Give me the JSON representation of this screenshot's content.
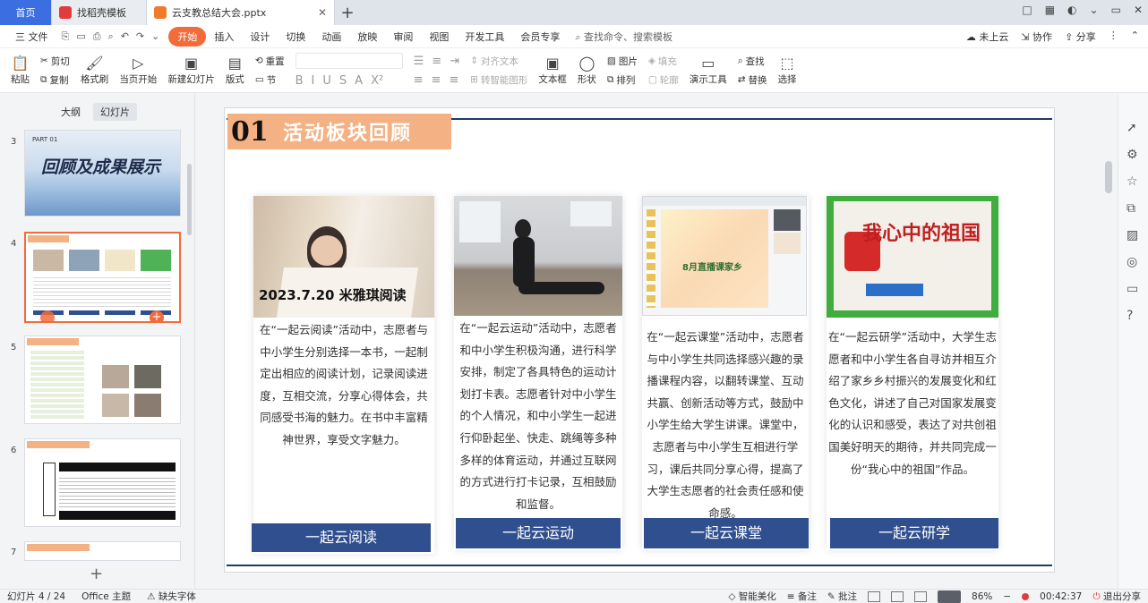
{
  "tabs": {
    "home": "首页",
    "t1": "找稻壳模板",
    "t2": "云支教总结大会.pptx",
    "add": "+"
  },
  "window_controls": [
    "□",
    "▦",
    "◐",
    "⌄",
    "▭",
    "✕"
  ],
  "menu": {
    "file": "三 文件",
    "quick_icons": [
      "⎘",
      "▭",
      "⎙",
      "⌕",
      "↶",
      "↷",
      "⌄"
    ],
    "items": [
      "开始",
      "插入",
      "设计",
      "切换",
      "动画",
      "放映",
      "审阅",
      "视图",
      "开发工具",
      "会员专享"
    ],
    "search": "⌕ 查找命令、搜索模板",
    "right": [
      "☁ 未上云",
      "⇲ 协作",
      "⇪ 分享",
      "⋮",
      "⌃"
    ]
  },
  "ribbon": {
    "paste": "粘贴",
    "cut": "剪切",
    "copy": "复制",
    "format_painter": "格式刷",
    "from_current": "当页开始",
    "new_slide": "新建幻灯片",
    "layout": "版式",
    "reset": "重置",
    "section": "节",
    "align_text": "对齐文本",
    "convert_smartart": "转智能图形",
    "text_box": "文本框",
    "shape": "形状",
    "picture": "图片",
    "fill": "填充",
    "arrange": "排列",
    "outline": "轮廓",
    "present_tools": "演示工具",
    "find": "查找",
    "replace": "替换",
    "select": "选择"
  },
  "left_panel": {
    "tab_outline": "大纲",
    "tab_slides": "幻灯片",
    "thumbs": [
      {
        "num": "3",
        "title": "回顾及成果展示",
        "part": "PART 01"
      },
      {
        "num": "4"
      },
      {
        "num": "5"
      },
      {
        "num": "6"
      },
      {
        "num": "7"
      }
    ],
    "add": "+"
  },
  "slide": {
    "number": "01",
    "title": "活动板块回顾",
    "cards": [
      {
        "photo_caption": "2023.7.20 米雅琪阅读",
        "desc": "在“一起云阅读”活动中，志愿者与中小学生分别选择一本书，一起制定出相应的阅读计划，记录阅读进度，互相交流，分享心得体会，共同感受书海的魅力。在书中丰富精神世界，享受文字魅力。",
        "label": "一起云阅读"
      },
      {
        "desc": "在“一起云运动”活动中，志愿者和中小学生积极沟通，进行科学安排，制定了各具特色的运动计划打卡表。志愿者针对中小学生的个人情况，和中小学生一起进行仰卧起坐、快走、跳绳等多种多样的体育运动，并通过互联网的方式进行打卡记录，互相鼓励和监督。",
        "label": "一起云运动"
      },
      {
        "photo_caption": "8月直播课家乡",
        "desc": "在“一起云课堂”活动中，志愿者与中小学生共同选择感兴趣的录播课程内容，以翻转课堂、互动共赢、创新活动等方式，鼓励中小学生给大学生讲课。课堂中，志愿者与中小学生互相进行学习，课后共同分享心得，提高了大学生志愿者的社会责任感和使命感。",
        "label": "一起云课堂"
      },
      {
        "photo_caption": "我心中的祖国",
        "desc": "在“一起云研学”活动中，大学生志愿者和中小学生各自寻访并相互介绍了家乡乡村振兴的发展变化和红色文化，讲述了自己对国家发展变化的认识和感受，表达了对共创祖国美好明天的期待，并共同完成一份“我心中的祖国”作品。",
        "label": "一起云研学"
      }
    ]
  },
  "status": {
    "slide_count": "幻灯片 4 / 24",
    "theme": "Office 主题",
    "missing_font": "缺失字体",
    "smart_beautify": "智能美化",
    "notes": "备注",
    "comments": "批注",
    "zoom": "86%",
    "timer": "00:42:37",
    "exit_share": "退出分享"
  },
  "colors": {
    "accent": "#f26b3a",
    "title_block": "#f4b183",
    "label_blue": "#2f4f8f",
    "rule_navy": "#1f3a66"
  }
}
